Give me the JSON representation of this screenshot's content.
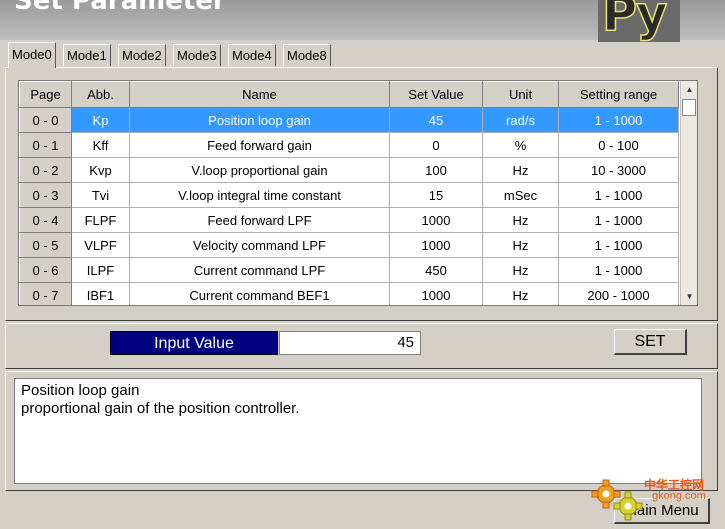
{
  "window": {
    "title": "Set Parameter",
    "logo_text": "Py"
  },
  "tabs": [
    {
      "label": "Mode0",
      "active": true
    },
    {
      "label": "Mode1",
      "active": false
    },
    {
      "label": "Mode2",
      "active": false
    },
    {
      "label": "Mode3",
      "active": false
    },
    {
      "label": "Mode4",
      "active": false
    },
    {
      "label": "Mode8",
      "active": false
    }
  ],
  "table": {
    "headers": [
      "Page",
      "Abb.",
      "Name",
      "Set Value",
      "Unit",
      "Setting range"
    ],
    "selected_row": 0,
    "rows": [
      [
        "0 - 0",
        "Kp",
        "Position loop gain",
        "45",
        "rad/s",
        "1 - 1000"
      ],
      [
        "0 - 1",
        "Kff",
        "Feed forward gain",
        "0",
        "%",
        "0 - 100"
      ],
      [
        "0 - 2",
        "Kvp",
        "V.loop proportional gain",
        "100",
        "Hz",
        "10 - 3000"
      ],
      [
        "0 - 3",
        "Tvi",
        "V.loop integral time constant",
        "15",
        "mSec",
        "1 - 1000"
      ],
      [
        "0 - 4",
        "FLPF",
        "Feed forward LPF",
        "1000",
        "Hz",
        "1 - 1000"
      ],
      [
        "0 - 5",
        "VLPF",
        "Velocity command LPF",
        "1000",
        "Hz",
        "1 - 1000"
      ],
      [
        "0 - 6",
        "ILPF",
        "Current command LPF",
        "450",
        "Hz",
        "1 - 1000"
      ],
      [
        "0 - 7",
        "IBF1",
        "Current command BEF1",
        "1000",
        "Hz",
        "200 - 1000"
      ]
    ]
  },
  "input": {
    "label": "Input Value",
    "value": "45",
    "set_button": "SET"
  },
  "description": {
    "line1": "Position loop gain",
    "line2": "proportional gain of the position controller."
  },
  "main_menu_button": "Main Menu",
  "watermark": {
    "line1": "中华工控网",
    "line2": "gkong.com"
  },
  "colors": {
    "selection": "#3399ff",
    "input_label_bg": "#000080",
    "watermark": "#e85a12"
  }
}
